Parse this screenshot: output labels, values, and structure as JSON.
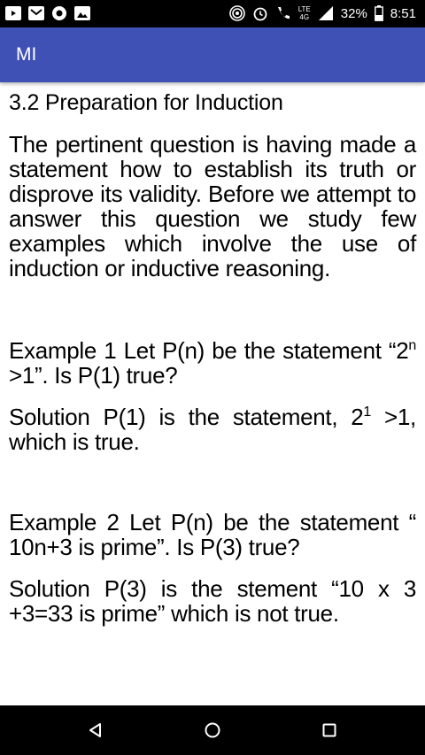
{
  "status_bar": {
    "network": "LTE",
    "signal_type": "4G",
    "battery": "32%",
    "time": "8:51",
    "icons": [
      "youtube-icon",
      "gmail-icon",
      "chrome-icon",
      "gallery-icon",
      "hotspot-icon",
      "alarm-icon",
      "call-icon",
      "signal-icon",
      "battery-icon"
    ]
  },
  "app_bar": {
    "title": "MI",
    "color": "#3f51b5"
  },
  "content": {
    "heading": "3.2 Preparation for Induction",
    "intro": "The pertinent question is having made a statement how to establish its truth or disprove its validity. Before we attempt to answer this question we study few examples which involve the use of induction or inductive reasoning.",
    "example1": {
      "part1": "Example 1 Let P(n) be the statement “2",
      "sup": "n",
      "part2": " >1”. Is P(1) true?"
    },
    "solution1": {
      "part1": "Solution P(1) is the statement, 2",
      "sup": "1",
      "part2": " >1, which is true."
    },
    "example2": "Example 2 Let P(n) be the statement “ 10n+3 is prime”. Is P(3) true?",
    "solution2": "Solution P(3) is the stement “10 x 3 +3=33 is prime” which is not true."
  },
  "nav_bar": {
    "buttons": [
      "back-icon",
      "home-icon",
      "recents-icon"
    ]
  }
}
